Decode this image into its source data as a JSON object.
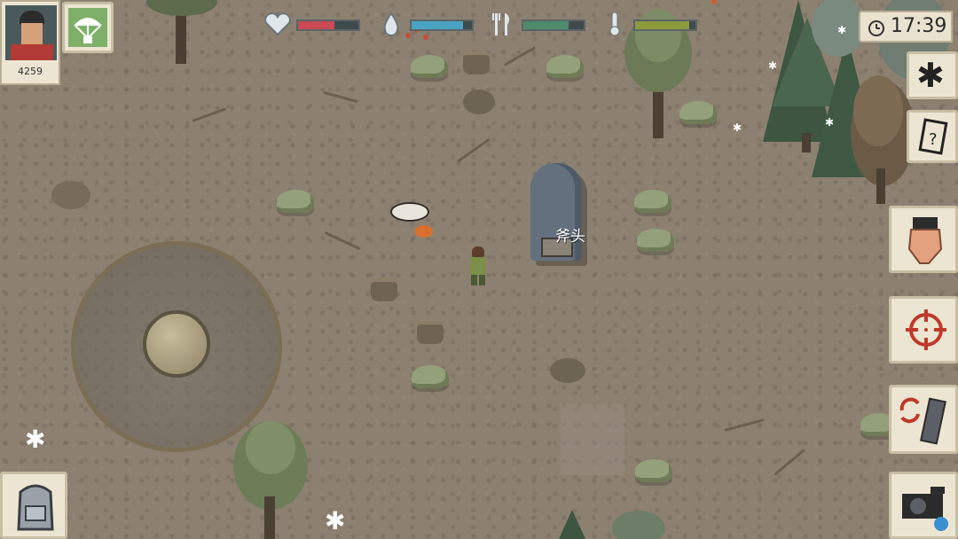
{
  "player": {
    "score": "4259"
  },
  "hud": {
    "stats": [
      {
        "name": "health",
        "icon": "heart-icon",
        "level": 0.6,
        "color": "#c94a55"
      },
      {
        "name": "thirst",
        "icon": "water-drop-icon",
        "level": 0.85,
        "color": "#4aa3c2"
      },
      {
        "name": "hunger",
        "icon": "fork-knife-icon",
        "level": 0.75,
        "color": "#4f8a6a"
      },
      {
        "name": "temperature",
        "icon": "thermometer-icon",
        "level": 0.9,
        "color": "#8a9a3c"
      }
    ],
    "clock": "17:39"
  },
  "world": {
    "item_label": "斧头"
  },
  "buttons": {
    "settings_icon": "gear-icon",
    "quest_icon": "scroll-icon",
    "grab_icon": "hand-icon",
    "aim_icon": "crosshair-icon",
    "swap_weapon_icon": "swap-weapon-icon",
    "camera_icon": "camera-icon",
    "backpack_icon": "backpack-icon",
    "airdrop_icon": "parachute-icon"
  }
}
